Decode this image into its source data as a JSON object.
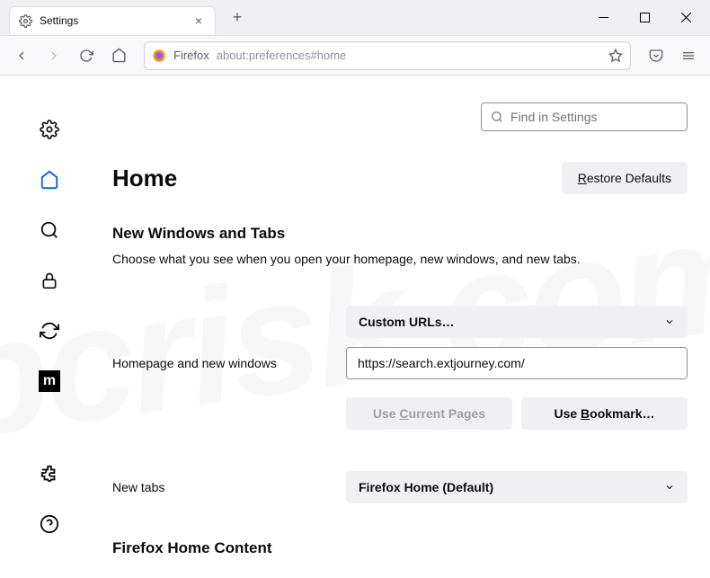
{
  "titlebar": {
    "tab_title": "Settings"
  },
  "urlbar": {
    "prefix": "Firefox",
    "url": "about:preferences#home"
  },
  "search": {
    "placeholder": "Find in Settings"
  },
  "header": {
    "title": "Home",
    "restore_label": "Restore Defaults"
  },
  "section1": {
    "title": "New Windows and Tabs",
    "desc": "Choose what you see when you open your homepage, new windows, and new tabs."
  },
  "homepage": {
    "label": "Homepage and new windows",
    "dropdown": "Custom URLs…",
    "url_value": "https://search.extjourney.com/",
    "current_pages_label": "Use Current Pages",
    "bookmark_label": "Use Bookmark…"
  },
  "newtabs": {
    "label": "New tabs",
    "dropdown": "Firefox Home (Default)"
  },
  "section2": {
    "title": "Firefox Home Content"
  },
  "sidebar_labels": {
    "general": "General",
    "home": "Home",
    "search": "Search",
    "privacy": "Privacy & Security",
    "sync": "Sync",
    "mozilla": "More from Mozilla",
    "extensions": "Extensions",
    "help": "Support"
  }
}
